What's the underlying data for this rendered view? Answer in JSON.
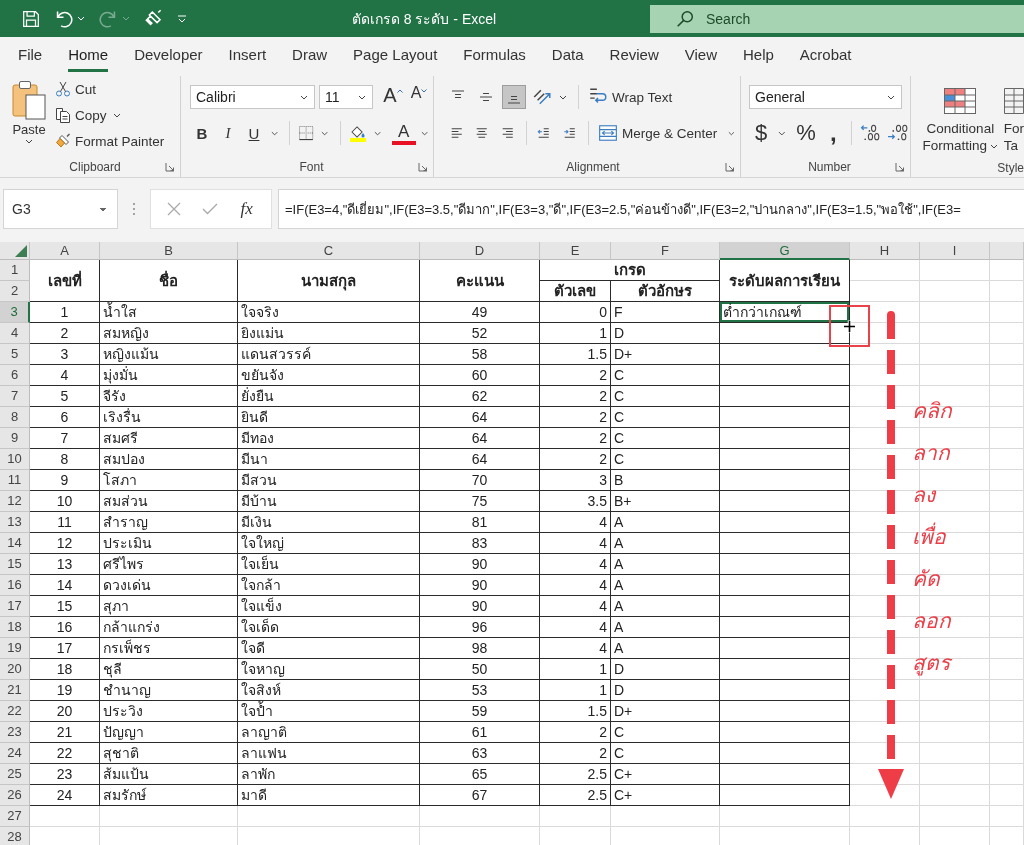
{
  "window": {
    "title": "ตัดเกรด 8 ระดับ - Excel"
  },
  "quick_access": {
    "redo_disabled": true
  },
  "search": {
    "placeholder": "Search"
  },
  "ribbon_tabs": [
    {
      "label": "File",
      "selected": false
    },
    {
      "label": "Home",
      "selected": true
    },
    {
      "label": "Developer",
      "selected": false
    },
    {
      "label": "Insert",
      "selected": false
    },
    {
      "label": "Draw",
      "selected": false
    },
    {
      "label": "Page Layout",
      "selected": false
    },
    {
      "label": "Formulas",
      "selected": false
    },
    {
      "label": "Data",
      "selected": false
    },
    {
      "label": "Review",
      "selected": false
    },
    {
      "label": "View",
      "selected": false
    },
    {
      "label": "Help",
      "selected": false
    },
    {
      "label": "Acrobat",
      "selected": false
    }
  ],
  "clipboard": {
    "label": "Clipboard",
    "paste": "Paste",
    "cut": "Cut",
    "copy": "Copy",
    "format_painter": "Format Painter"
  },
  "font": {
    "label": "Font",
    "font_name": "Calibri",
    "font_size": "11",
    "grow": "A",
    "shrink": "A",
    "bold": "B",
    "italic": "I",
    "underline": "U",
    "font_color": "A"
  },
  "alignment": {
    "label": "Alignment",
    "vertical": [
      {
        "selected": false
      },
      {
        "selected": false
      },
      {
        "selected": true
      }
    ],
    "wrap_text": "Wrap Text",
    "merge_center": "Merge & Center"
  },
  "number": {
    "label": "Number",
    "format": "General",
    "currency": "$",
    "percent": "%",
    "comma": ","
  },
  "styles": {
    "label": "Style",
    "conditional_formatting": "Conditional Formatting",
    "format_as_table": [
      "For",
      "Ta"
    ]
  },
  "formula_bar": {
    "name_box": "G3",
    "function_button": "fx",
    "formula": "=IF(E3=4,\"ดีเยี่ยม\",IF(E3=3.5,\"ดีมาก\",IF(E3=3,\"ดี\",IF(E3=2.5,\"ค่อนข้างดี\",IF(E3=2,\"ปานกลาง\",IF(E3=1.5,\"พอใช้\",IF(E3="
  },
  "sheet": {
    "columns": [
      {
        "label": "A",
        "selected": false
      },
      {
        "label": "B",
        "selected": false
      },
      {
        "label": "C",
        "selected": false
      },
      {
        "label": "D",
        "selected": false
      },
      {
        "label": "E",
        "selected": false
      },
      {
        "label": "F",
        "selected": false
      },
      {
        "label": "G",
        "selected": true
      },
      {
        "label": "H",
        "selected": false
      },
      {
        "label": "I",
        "selected": false
      }
    ],
    "row_numbers": [
      {
        "label": "1",
        "selected": false
      },
      {
        "label": "2",
        "selected": false
      },
      {
        "label": "3",
        "selected": true
      },
      {
        "label": "4",
        "selected": false
      },
      {
        "label": "5",
        "selected": false
      },
      {
        "label": "6",
        "selected": false
      },
      {
        "label": "7",
        "selected": false
      },
      {
        "label": "8",
        "selected": false
      },
      {
        "label": "9",
        "selected": false
      },
      {
        "label": "10",
        "selected": false
      },
      {
        "label": "11",
        "selected": false
      },
      {
        "label": "12",
        "selected": false
      },
      {
        "label": "13",
        "selected": false
      },
      {
        "label": "14",
        "selected": false
      },
      {
        "label": "15",
        "selected": false
      },
      {
        "label": "16",
        "selected": false
      },
      {
        "label": "17",
        "selected": false
      },
      {
        "label": "18",
        "selected": false
      },
      {
        "label": "19",
        "selected": false
      },
      {
        "label": "20",
        "selected": false
      },
      {
        "label": "21",
        "selected": false
      },
      {
        "label": "22",
        "selected": false
      },
      {
        "label": "23",
        "selected": false
      },
      {
        "label": "24",
        "selected": false
      },
      {
        "label": "25",
        "selected": false
      },
      {
        "label": "26",
        "selected": false
      },
      {
        "label": "27",
        "selected": false
      },
      {
        "label": "28",
        "selected": false
      }
    ],
    "header": {
      "number": "เลขที่",
      "first_name": "ชื่อ",
      "last_name": "นามสกุล",
      "score": "คะแนน",
      "grade": "เกรด",
      "grade_number": "ตัวเลข",
      "grade_letter": "ตัวอักษร",
      "level": "ระดับผลการเรียน"
    },
    "rows": [
      {
        "no": "1",
        "first_name": "น้ำใส",
        "last_name": "ใจจริง",
        "score": "49",
        "grade_number": "0",
        "grade_letter": "F",
        "level": "ต่ำกว่าเกณฑ์",
        "selected": true
      },
      {
        "no": "2",
        "first_name": "สมหญิง",
        "last_name": "ยิงแม่น",
        "score": "52",
        "grade_number": "1",
        "grade_letter": "D",
        "selected": false
      },
      {
        "no": "3",
        "first_name": "หญิงแม้น",
        "last_name": "แดนสวรรค์",
        "score": "58",
        "grade_number": "1.5",
        "grade_letter": "D+",
        "selected": false
      },
      {
        "no": "4",
        "first_name": "มุ่งมั่น",
        "last_name": "ขยันจัง",
        "score": "60",
        "grade_number": "2",
        "grade_letter": "C",
        "selected": false
      },
      {
        "no": "5",
        "first_name": "จีรัง",
        "last_name": "ยั่งยืน",
        "score": "62",
        "grade_number": "2",
        "grade_letter": "C",
        "selected": false
      },
      {
        "no": "6",
        "first_name": "เริงรื่น",
        "last_name": "ยินดี",
        "score": "64",
        "grade_number": "2",
        "grade_letter": "C",
        "selected": false
      },
      {
        "no": "7",
        "first_name": "สมศรี",
        "last_name": "มีทอง",
        "score": "64",
        "grade_number": "2",
        "grade_letter": "C",
        "selected": false
      },
      {
        "no": "8",
        "first_name": "สมปอง",
        "last_name": "มีนา",
        "score": "64",
        "grade_number": "2",
        "grade_letter": "C",
        "selected": false
      },
      {
        "no": "9",
        "first_name": "โสภา",
        "last_name": "มีสวน",
        "score": "70",
        "grade_number": "3",
        "grade_letter": "B",
        "selected": false
      },
      {
        "no": "10",
        "first_name": "สมส่วน",
        "last_name": "มีบ้าน",
        "score": "75",
        "grade_number": "3.5",
        "grade_letter": "B+",
        "selected": false
      },
      {
        "no": "11",
        "first_name": "สำราญ",
        "last_name": "มีเงิน",
        "score": "81",
        "grade_number": "4",
        "grade_letter": "A",
        "selected": false
      },
      {
        "no": "12",
        "first_name": "ประเมิน",
        "last_name": "ใจใหญ่",
        "score": "83",
        "grade_number": "4",
        "grade_letter": "A",
        "selected": false
      },
      {
        "no": "13",
        "first_name": "ศรีไพร",
        "last_name": "ใจเย็น",
        "score": "90",
        "grade_number": "4",
        "grade_letter": "A",
        "selected": false
      },
      {
        "no": "14",
        "first_name": "ดวงเด่น",
        "last_name": "ใจกล้า",
        "score": "90",
        "grade_number": "4",
        "grade_letter": "A",
        "selected": false
      },
      {
        "no": "15",
        "first_name": "สุภา",
        "last_name": "ใจแข็ง",
        "score": "90",
        "grade_number": "4",
        "grade_letter": "A",
        "selected": false
      },
      {
        "no": "16",
        "first_name": "กล้าแกร่ง",
        "last_name": "ใจเด็ด",
        "score": "96",
        "grade_number": "4",
        "grade_letter": "A",
        "selected": false
      },
      {
        "no": "17",
        "first_name": "กรเพ็ชร",
        "last_name": "ใจดี",
        "score": "98",
        "grade_number": "4",
        "grade_letter": "A",
        "selected": false
      },
      {
        "no": "18",
        "first_name": "ชุลี",
        "last_name": "ใจหาญ",
        "score": "50",
        "grade_number": "1",
        "grade_letter": "D",
        "selected": false
      },
      {
        "no": "19",
        "first_name": "ชำนาญ",
        "last_name": "ใจสิงห์",
        "score": "53",
        "grade_number": "1",
        "grade_letter": "D",
        "selected": false
      },
      {
        "no": "20",
        "first_name": "ประวิง",
        "last_name": "ใจป้ำ",
        "score": "59",
        "grade_number": "1.5",
        "grade_letter": "D+",
        "selected": false
      },
      {
        "no": "21",
        "first_name": "ปัญญา",
        "last_name": "ลาญาติ",
        "score": "61",
        "grade_number": "2",
        "grade_letter": "C",
        "selected": false
      },
      {
        "no": "22",
        "first_name": "สุชาติ",
        "last_name": "ลาแฟน",
        "score": "63",
        "grade_number": "2",
        "grade_letter": "C",
        "selected": false
      },
      {
        "no": "23",
        "first_name": "ส้มแป้น",
        "last_name": "ลาพัก",
        "score": "65",
        "grade_number": "2.5",
        "grade_letter": "C+",
        "selected": false
      },
      {
        "no": "24",
        "first_name": "สมรักษ์",
        "last_name": "มาดี",
        "score": "67",
        "grade_number": "2.5",
        "grade_letter": "C+",
        "selected": false
      }
    ]
  },
  "annotation": {
    "words": [
      "คลิก",
      "ลาก",
      "ลง",
      "เพื่อ",
      "คัด",
      "ลอก",
      "สูตร"
    ]
  }
}
